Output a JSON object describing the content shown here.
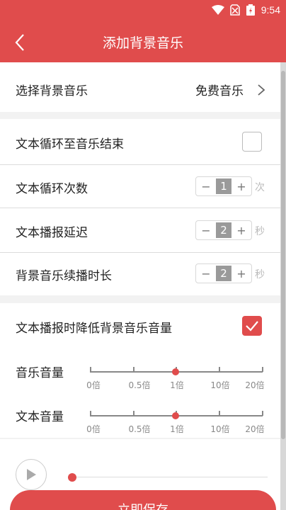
{
  "status_bar": {
    "time": "9:54"
  },
  "nav": {
    "title": "添加背景音乐"
  },
  "settings": {
    "bg_music": {
      "label": "选择背景音乐",
      "value": "免费音乐"
    },
    "loop_to_end": {
      "label": "文本循环至音乐结束",
      "checked": false
    },
    "loop_count": {
      "label": "文本循环次数",
      "minus": "−",
      "value": "1",
      "plus": "+",
      "unit": "次"
    },
    "broadcast_delay": {
      "label": "文本播报延迟",
      "minus": "−",
      "value": "2",
      "plus": "+",
      "unit": "秒"
    },
    "music_continue": {
      "label": "背景音乐续播时长",
      "minus": "−",
      "value": "2",
      "plus": "+",
      "unit": "秒"
    },
    "duck_music": {
      "label": "文本播报时降低背景音乐音量",
      "checked": true
    }
  },
  "volume": {
    "tick_labels": [
      "0倍",
      "0.5倍",
      "1倍",
      "10倍",
      "20倍"
    ],
    "music": {
      "label": "音乐音量",
      "value": "1倍"
    },
    "text": {
      "label": "文本音量",
      "value": "1倍"
    }
  },
  "player": {
    "progress": 0
  },
  "save_button": {
    "label": "立即保存"
  },
  "colors": {
    "accent": "#e04c4c"
  }
}
